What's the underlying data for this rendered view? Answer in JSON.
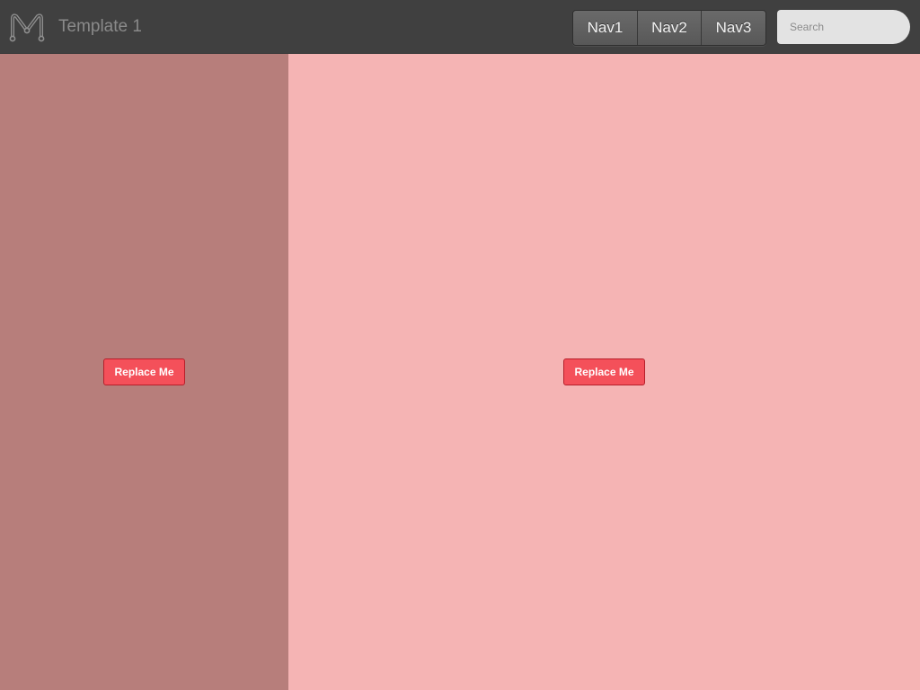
{
  "header": {
    "logo_icon": "m-logo-icon",
    "title": "Template 1"
  },
  "nav": {
    "items": [
      {
        "label": "Nav1"
      },
      {
        "label": "Nav2"
      },
      {
        "label": "Nav3"
      }
    ]
  },
  "search": {
    "placeholder": "Search",
    "value": ""
  },
  "left_pane": {
    "button_label": "Replace Me",
    "background": "#b77e7b"
  },
  "right_pane": {
    "button_label": "Replace Me",
    "background": "#f5b4b4"
  },
  "colors": {
    "topbar": "#404040",
    "button": "#f4505a"
  }
}
